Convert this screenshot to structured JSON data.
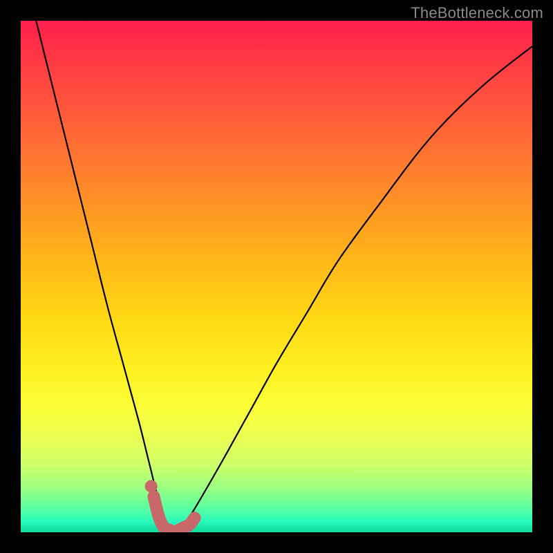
{
  "watermark": "TheBottleneck.com",
  "chart_data": {
    "type": "line",
    "title": "",
    "xlabel": "",
    "ylabel": "",
    "xlim": [
      0,
      100
    ],
    "ylim": [
      0,
      100
    ],
    "grid": false,
    "annotations": [],
    "series": [
      {
        "name": "bottleneck-curve",
        "x": [
          3,
          5,
          8,
          11,
          14,
          17,
          20,
          23,
          25,
          26.5,
          28,
          29,
          30,
          31.5,
          33,
          36,
          40,
          45,
          50,
          56,
          62,
          70,
          80,
          90,
          100
        ],
        "values": [
          100,
          92,
          80,
          68,
          56,
          44,
          33,
          22,
          14,
          8,
          3,
          1,
          0,
          1,
          3,
          8,
          15,
          24,
          33,
          43,
          53,
          64,
          77,
          87,
          95
        ]
      }
    ],
    "highlight": {
      "name": "optimal-band",
      "x": [
        26,
        27,
        28,
        29,
        30,
        31,
        32,
        33,
        34
      ],
      "values": [
        7,
        3,
        1,
        0.5,
        0,
        0.5,
        1,
        1.5,
        2.8
      ],
      "dot": {
        "x": 25.5,
        "value": 9
      }
    },
    "background_gradient": {
      "top": "#ff1f4c",
      "mid": "#fff020",
      "bottom": "#14d99c"
    }
  }
}
